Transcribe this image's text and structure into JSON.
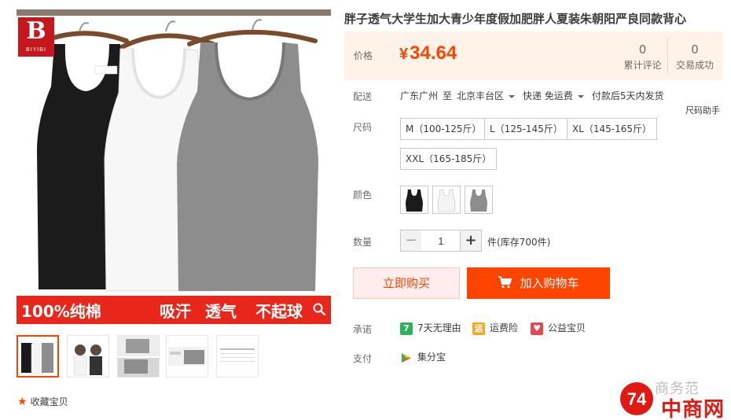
{
  "gallery": {
    "brand_logo": {
      "letter": "B",
      "name": "BIYIBI"
    },
    "banner": {
      "text1": "100%纯棉",
      "text2": "吸汗",
      "text3": "透气",
      "text4": "不起球"
    },
    "thumbnail_count": 5,
    "active_thumbnail": 0
  },
  "favorite": {
    "icon": "star-icon",
    "label": "收藏宝贝"
  },
  "product": {
    "title": "胖子透气大学生加大青少年度假加肥胖人夏装朱朝阳严良同款背心"
  },
  "price": {
    "label": "价格",
    "currency": "¥",
    "value": "34.64",
    "reviews_count": "0",
    "reviews_label": "累计评论",
    "sales_count": "0",
    "sales_label": "交易成功"
  },
  "shipping": {
    "label": "配送",
    "from": "广东广州",
    "to_word": "至",
    "to": "北京丰台区",
    "courier": "快递 免运费",
    "dispatch": "付款后5天内发货"
  },
  "size": {
    "label": "尺码",
    "help": "尺码助手",
    "options": [
      "M（100-125斤）",
      "L（125-145斤）",
      "XL（145-165斤）",
      "XXL（165-185斤）"
    ]
  },
  "color": {
    "label": "颜色",
    "options": [
      {
        "name": "black",
        "hex": "#1b1b1b"
      },
      {
        "name": "white",
        "hex": "#f4f4f4"
      },
      {
        "name": "gray",
        "hex": "#8d8d8d"
      }
    ]
  },
  "quantity": {
    "label": "数量",
    "minus": "−",
    "plus": "+",
    "value": "1",
    "stock": "件(库存700件)"
  },
  "actions": {
    "buy_now": "立即购买",
    "add_to_cart": "加入购物车"
  },
  "promise": {
    "label": "承诺",
    "items": [
      {
        "icon": "seven-days-icon",
        "glyph": "7",
        "color": "#2bb45a",
        "text": "7天无理由"
      },
      {
        "icon": "shipping-insurance-icon",
        "glyph": "运",
        "color": "#f5a623",
        "text": "运费险"
      },
      {
        "icon": "charity-icon",
        "glyph": "♥",
        "color": "#e8474f",
        "text": "公益宝贝"
      }
    ]
  },
  "payment": {
    "label": "支付",
    "method": "集分宝",
    "icon": "jifenbao-icon"
  },
  "watermark": {
    "top": "商务范",
    "name": "中商网"
  },
  "colors": {
    "accent": "#ff4400",
    "price_bg": "#fff2e8",
    "buy_now_bg": "#ffeded"
  }
}
